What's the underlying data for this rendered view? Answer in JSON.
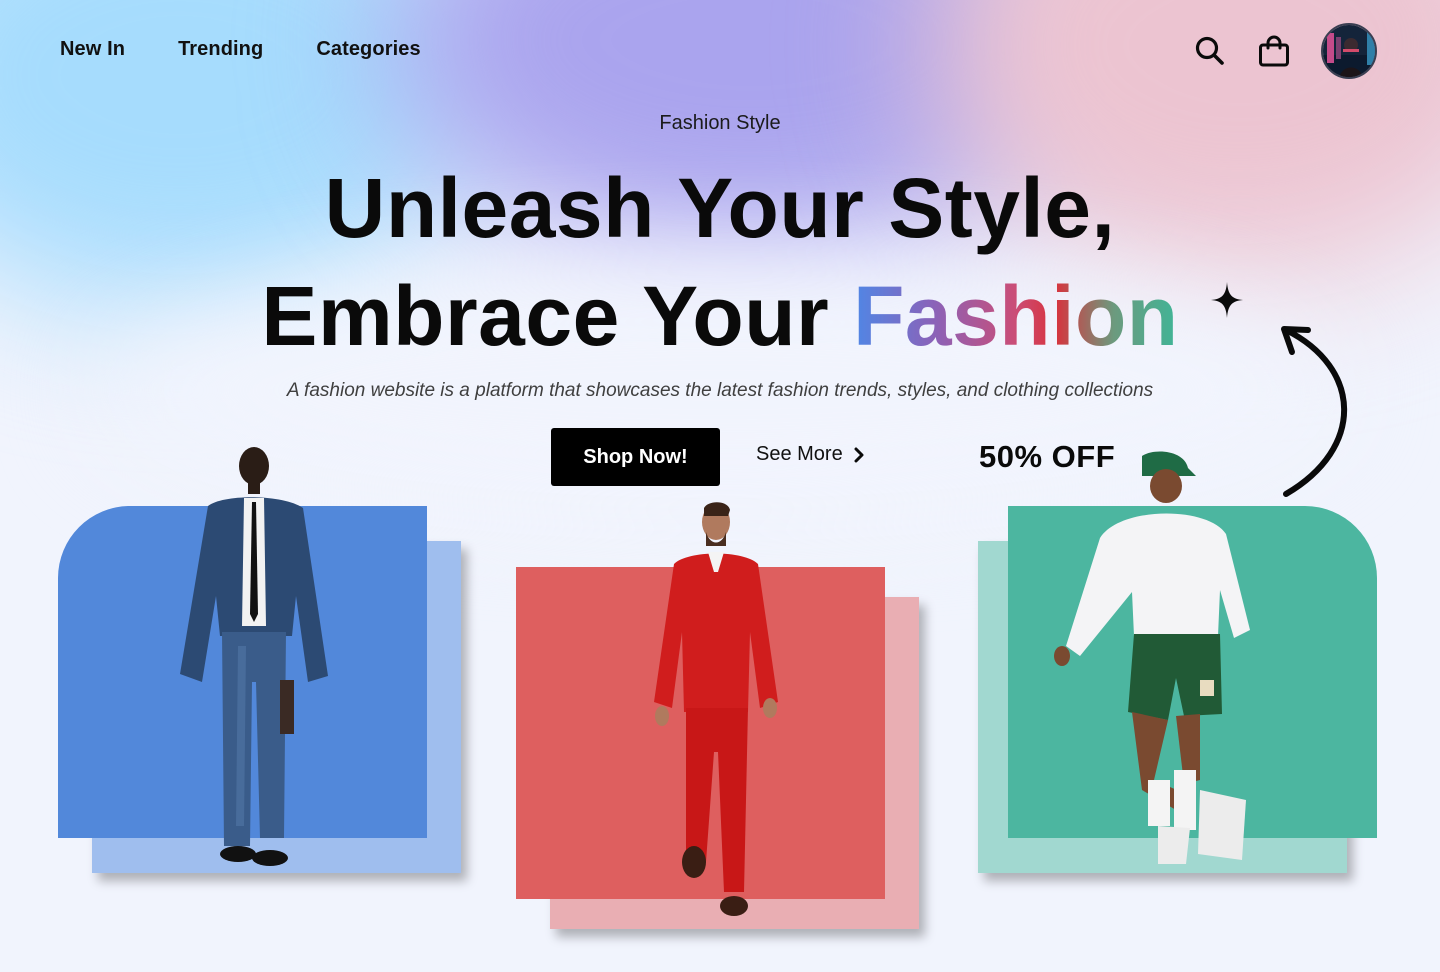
{
  "nav": {
    "items": [
      "New In",
      "Trending",
      "Categories"
    ]
  },
  "header": {
    "search_icon": "search-icon",
    "bag_icon": "shopping-bag-icon",
    "avatar": "user-avatar"
  },
  "hero": {
    "eyebrow": "Fashion Style",
    "line1": "Unleash Your Style,",
    "line2_prefix": "Embrace Your ",
    "line2_highlight": "Fashion",
    "tagline": "A fashion website is a platform that showcases the  latest fashion trends, styles, and clothing collections",
    "primary_cta": "Shop Now!",
    "secondary_cta": "See More",
    "promo": "50% OFF"
  },
  "cards": [
    {
      "accent": "#5288da",
      "shadow": "#9fbeee"
    },
    {
      "accent": "#de5f5f",
      "shadow": "#e9aeb3"
    },
    {
      "accent": "#4cb6a0",
      "shadow": "#a1d8d0"
    }
  ],
  "colors": {
    "background": "#f1f4fd",
    "button": "#000000",
    "text": "#0a0a0a"
  }
}
